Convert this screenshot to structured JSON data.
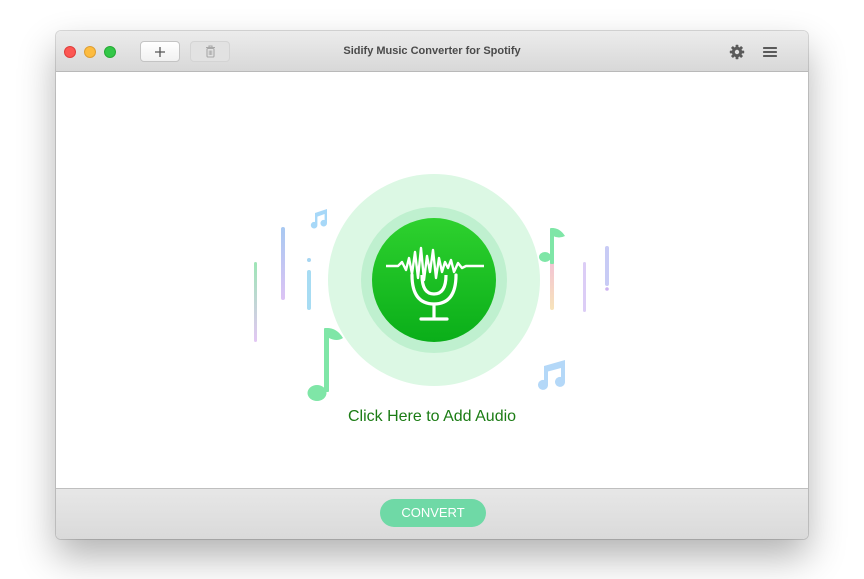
{
  "window": {
    "title": "Sidify Music Converter for Spotify"
  },
  "toolbar": {
    "add_icon": "plus-icon",
    "delete_icon": "trash-icon",
    "settings_icon": "gear-icon",
    "menu_icon": "hamburger-menu-icon"
  },
  "main": {
    "add_audio_label": "Click Here to Add Audio",
    "center_icon": "microphone-soundwave-icon"
  },
  "footer": {
    "convert_label": "CONVERT"
  },
  "colors": {
    "accent_green": "#1bc21b",
    "label_green": "#1b7c14",
    "convert_button": "#6fd9a6"
  }
}
